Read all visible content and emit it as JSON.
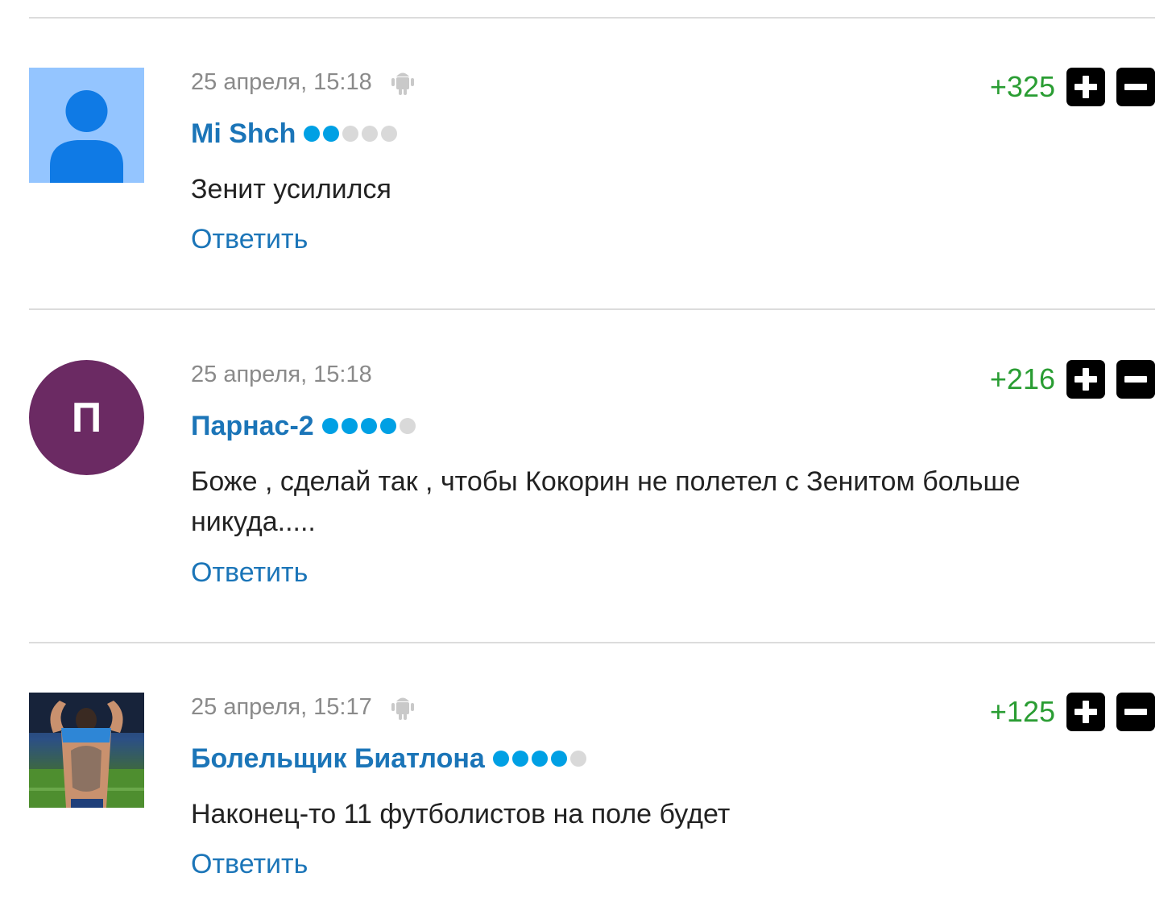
{
  "comments": [
    {
      "date": "25 апреля, 15:18",
      "device_icon": "android-icon",
      "author": "Mi Shch",
      "rank_dots": [
        1,
        1,
        0,
        0,
        0
      ],
      "text": "Зенит усилился",
      "reply_label": "Ответить",
      "rating": "+325",
      "avatar_type": "default"
    },
    {
      "date": "25 апреля, 15:18",
      "device_icon": "",
      "author": "Парнас-2",
      "rank_dots": [
        1,
        1,
        1,
        1,
        0
      ],
      "text": "Боже , сделай так , чтобы Кокорин не полетел с Зенитом больше никуда.....",
      "reply_label": "Ответить",
      "rating": "+216",
      "avatar_type": "letter",
      "avatar_letter": "П",
      "avatar_color": "#6b2a63"
    },
    {
      "date": "25 апреля, 15:17",
      "device_icon": "android-icon",
      "author": "Болельщик Биатлона",
      "rank_dots": [
        1,
        1,
        1,
        1,
        0
      ],
      "text": "Наконец-то 11 футболистов на поле будет",
      "reply_label": "Ответить",
      "rating": "+125",
      "avatar_type": "photo"
    }
  ],
  "colors": {
    "author": "#1b75b8",
    "rating_positive": "#2a9d33",
    "rank_dot_on": "#00a0e4",
    "rank_dot_off": "#d9d9d9",
    "divider": "#dcdcdc"
  }
}
